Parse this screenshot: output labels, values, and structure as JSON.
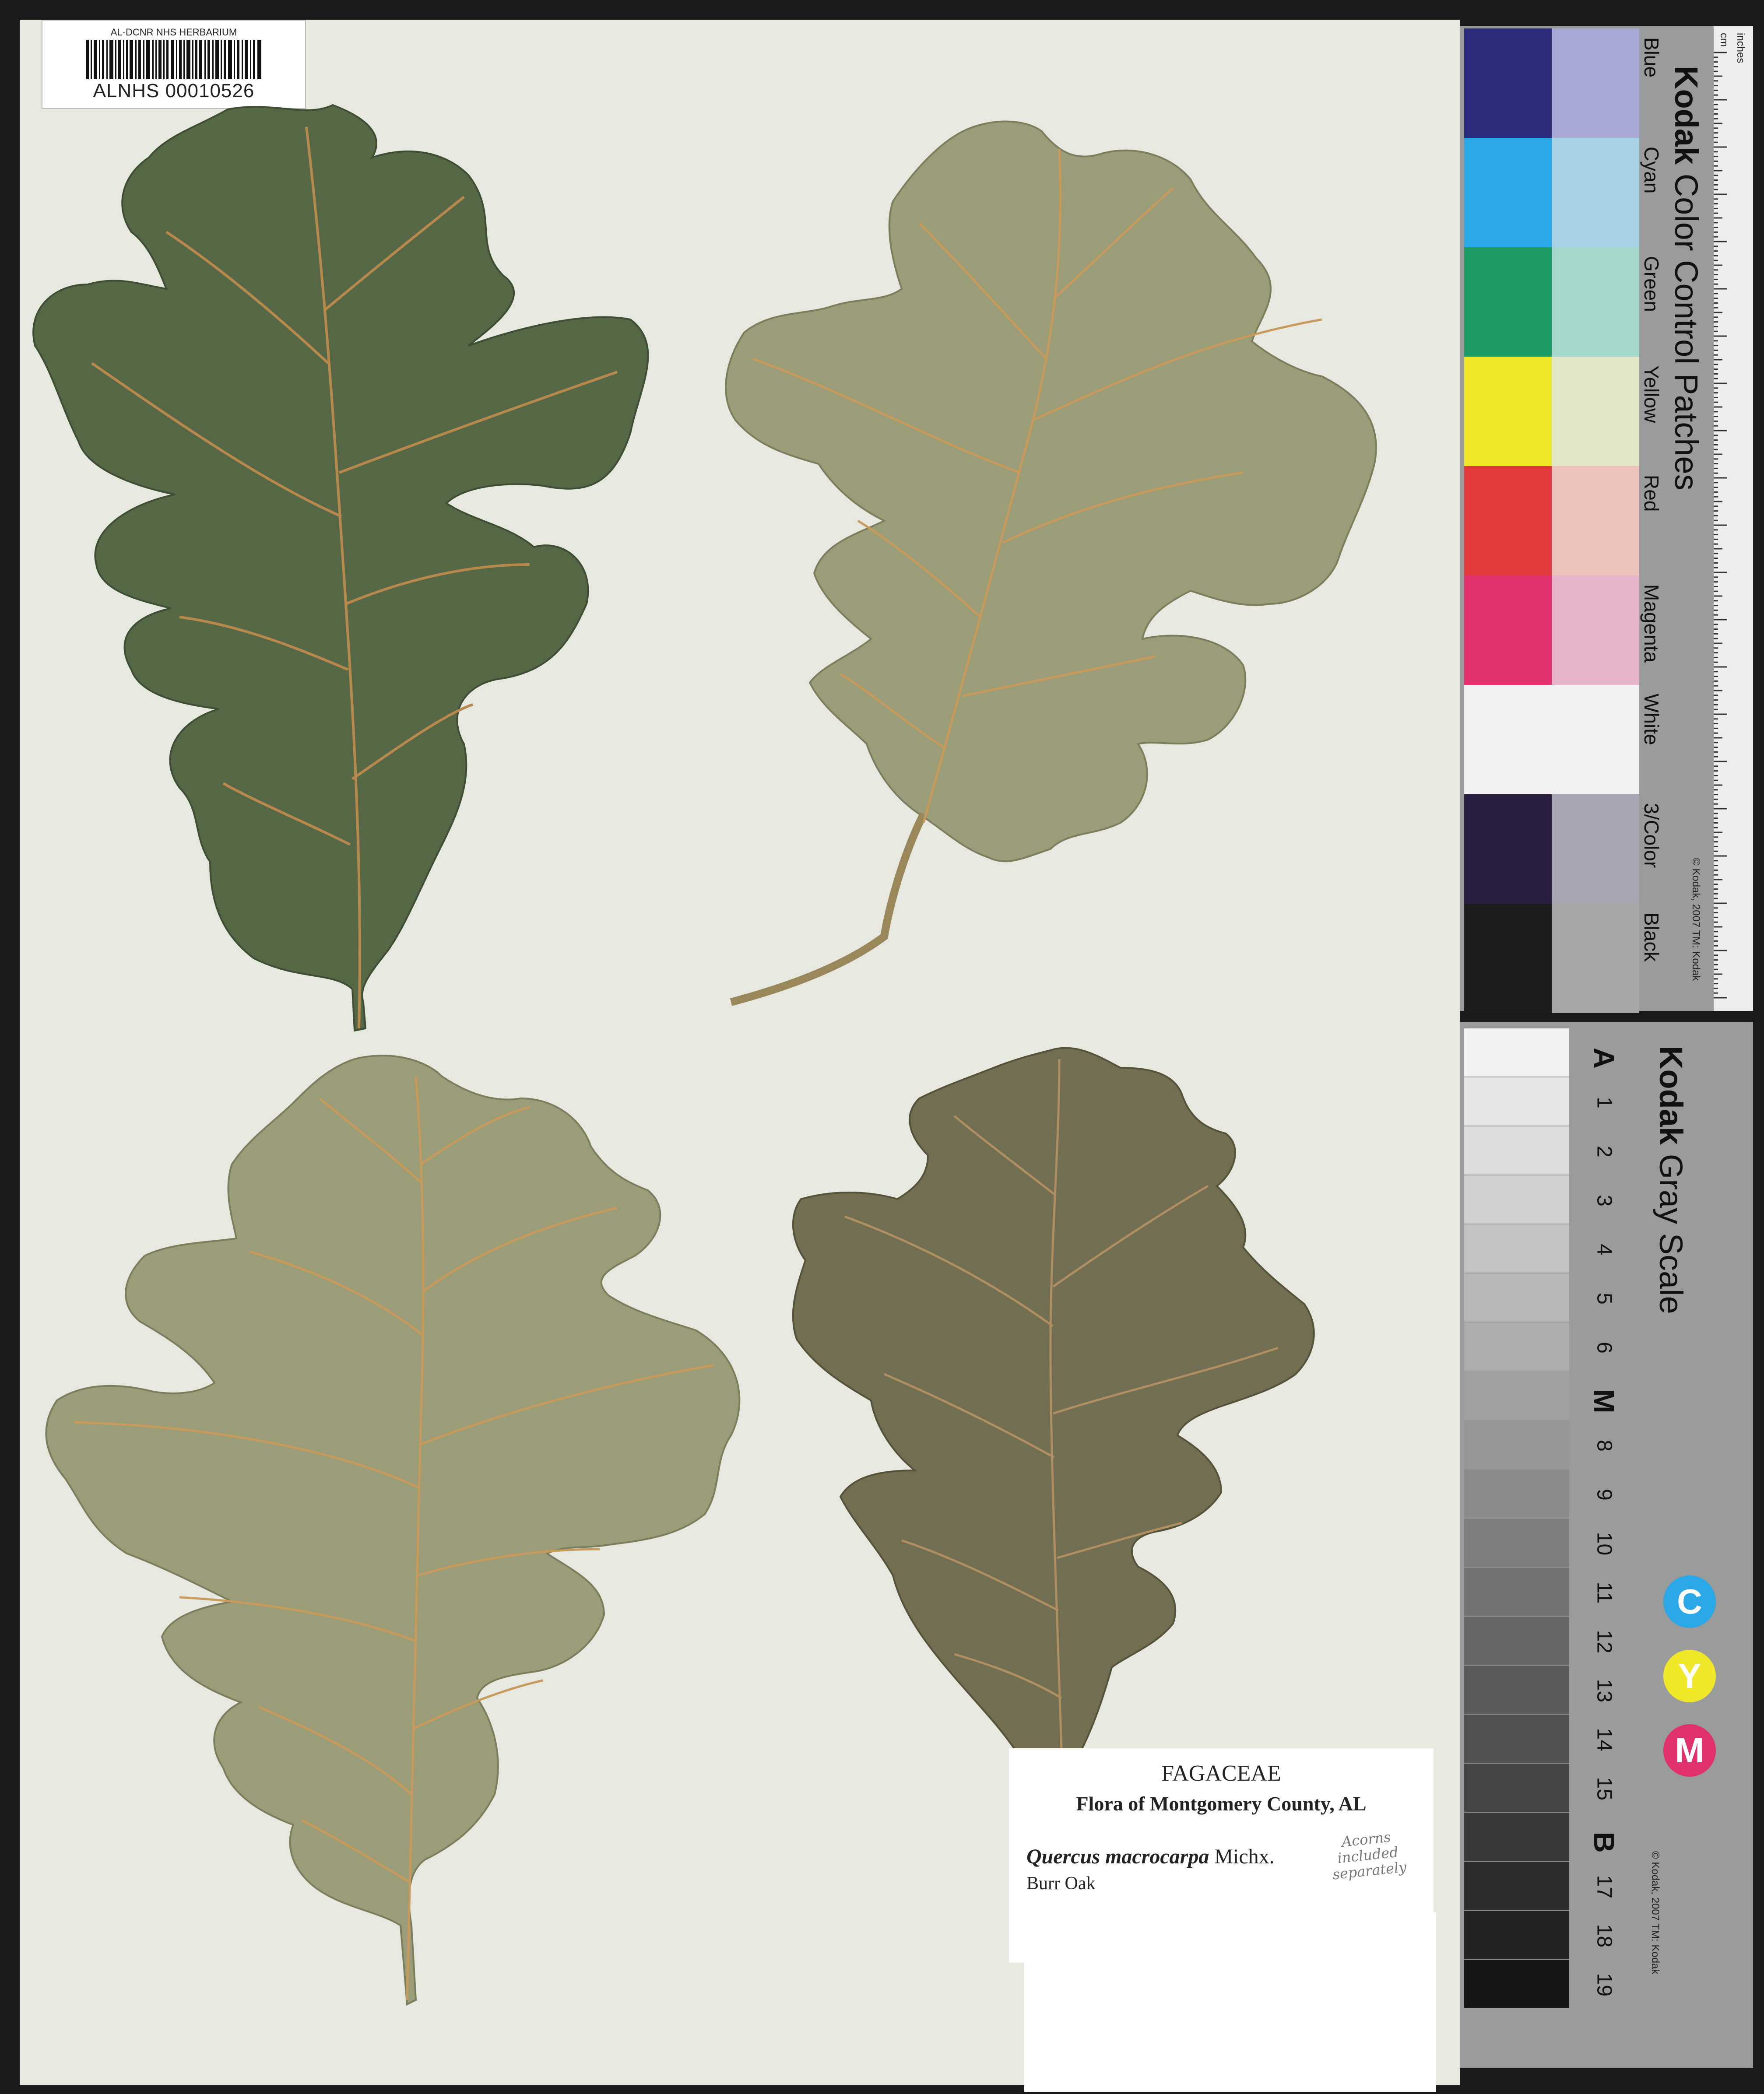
{
  "barcode": {
    "institution": "AL-DCNR NHS HERBARIUM",
    "accession": "ALNHS 00010526"
  },
  "label": {
    "family": "FAGACEAE",
    "flora": "Flora of Montgomery County, AL",
    "species": "Quercus macrocarpa",
    "author": "Michx.",
    "common_name": "Burr Oak",
    "note_line1": "Acorns included",
    "note_line2": "separately"
  },
  "color_chart": {
    "brand": "Kodak",
    "title": "Color Control Patches",
    "patches": [
      {
        "name": "Blue",
        "main": "#2c2a7a",
        "light": "#a9a9d8"
      },
      {
        "name": "Cyan",
        "main": "#2aa7e6",
        "light": "#a7d3e9"
      },
      {
        "name": "Green",
        "main": "#1b9a63",
        "light": "#a4d8cc"
      },
      {
        "name": "Yellow",
        "main": "#f0e728",
        "light": "#e4e6c9"
      },
      {
        "name": "Red",
        "main": "#e23a3a",
        "light": "#ecc2bd"
      },
      {
        "name": "Magenta",
        "main": "#e0306e",
        "light": "#e8b4cb"
      },
      {
        "name": "White",
        "main": "#f1f1f1",
        "light": "#f1f1f1"
      },
      {
        "name": "3/Color",
        "main": "#2a1f40",
        "light": "#a7a5b3"
      },
      {
        "name": "Black",
        "main": "#1c1c1c",
        "light": "#a5a5a5"
      }
    ],
    "copyright": "© Kodak, 2007 TM: Kodak",
    "ruler_units_top": "inches",
    "ruler_units_bottom": "cm"
  },
  "gray_chart": {
    "brand": "Kodak",
    "title": "Gray Scale",
    "steps": [
      "A",
      "1",
      "2",
      "3",
      "4",
      "5",
      "6",
      "M",
      "8",
      "9",
      "10",
      "11",
      "12",
      "13",
      "14",
      "15",
      "B",
      "17",
      "18",
      "19"
    ],
    "cym": [
      "C",
      "Y",
      "M"
    ],
    "copyright": "© Kodak, 2007 TM: Kodak"
  },
  "colors": {
    "leaf_dark": "#556745",
    "leaf_pale": "#9a9d77",
    "leaf_olive": "#716e52",
    "vein": "#b88a4c",
    "sheet": "#e7e9e1"
  }
}
